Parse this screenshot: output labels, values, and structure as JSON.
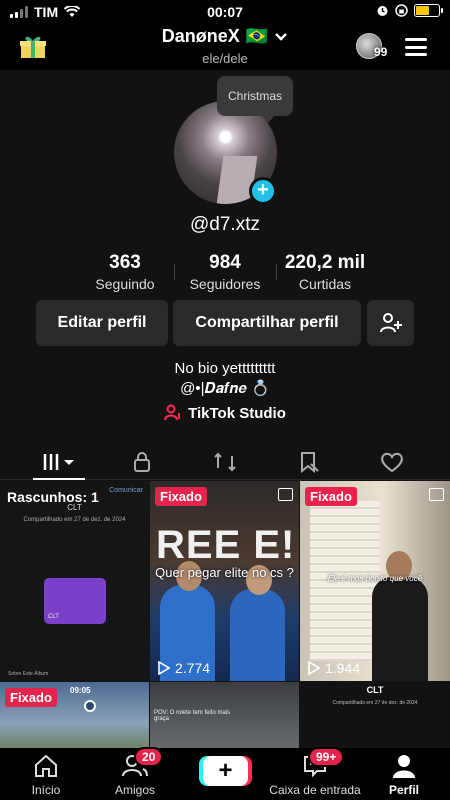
{
  "status_bar": {
    "carrier": "TIM",
    "time": "00:07"
  },
  "header": {
    "username": "DanøneX",
    "flag": "🇧🇷",
    "pronouns": "ele/dele",
    "avatar_count": "99"
  },
  "profile": {
    "tooltip": "Christmas",
    "handle": "@d7.xtz",
    "stats": [
      {
        "value": "363",
        "label": "Seguindo"
      },
      {
        "value": "984",
        "label": "Seguidores"
      },
      {
        "value": "220,2 mil",
        "label": "Curtidas"
      }
    ],
    "buttons": {
      "edit": "Editar perfil",
      "share": "Compartilhar perfil"
    },
    "bio_line1": "No bio yettttttttt",
    "bio_line2": "@•|𝑫𝒂𝒇𝒏𝒆 💍",
    "studio": "TikTok Studio"
  },
  "grid": {
    "drafts": {
      "label": "Rascunhos: 1",
      "action": "Comunicar",
      "shared": "Compartilhado em 27 de dez. de 2024",
      "clt": "CLT",
      "card_label": "CLT",
      "footer": "Sobre Este Álbum"
    },
    "pinned_label": "Fixado",
    "video1": {
      "caption": "Quer pegar elite no cs ?",
      "banner": "REE E!",
      "views": "2.774"
    },
    "video2": {
      "caption": "Ele é mos bonito que você",
      "views": "1.944"
    },
    "video3": {
      "time": "09:05"
    },
    "video4": {
      "caption": "POV: O rolete tem feito mais graça"
    },
    "video5": {
      "clt": "CLT",
      "shared": "Compartilhado em 27 de dez. de 2024"
    }
  },
  "nav": {
    "items": [
      {
        "label": "Início"
      },
      {
        "label": "Amigos",
        "badge": "20"
      },
      {
        "label": ""
      },
      {
        "label": "Caixa de entrada",
        "badge": "99+"
      },
      {
        "label": "Perfil"
      }
    ]
  },
  "colors": {
    "accent_red": "#e6234a",
    "accent_cyan": "#21c0e8",
    "background": "#121212"
  }
}
